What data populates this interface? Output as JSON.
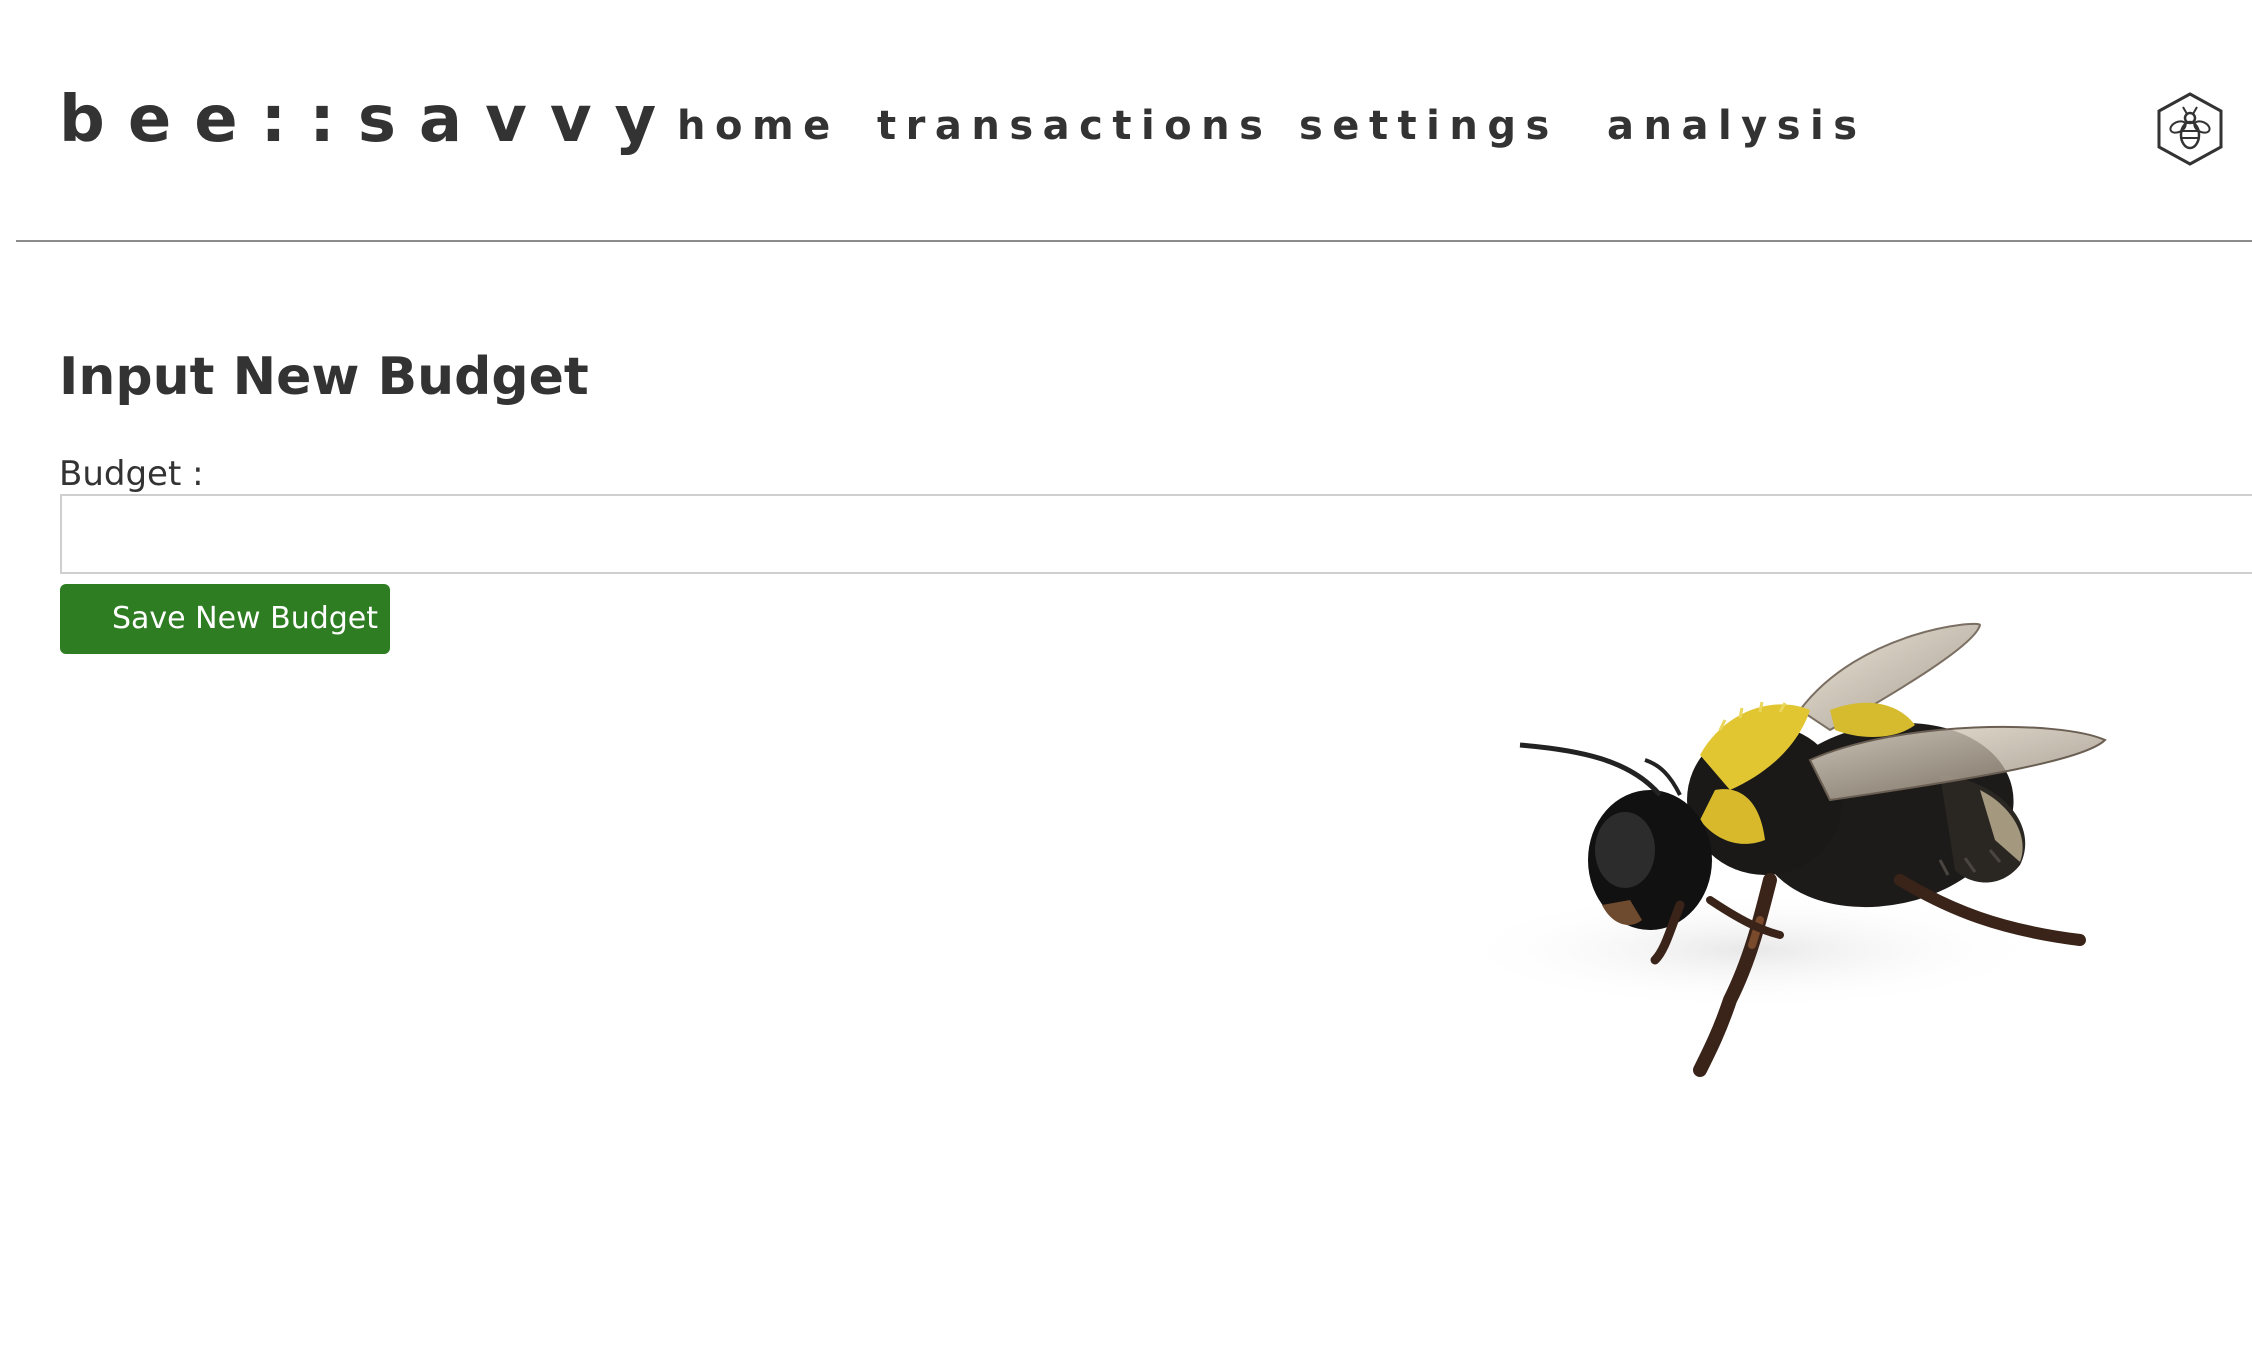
{
  "header": {
    "brand": "bee::savvy",
    "nav": [
      {
        "label": "home"
      },
      {
        "label": "transactions"
      },
      {
        "label": "settings"
      },
      {
        "label": "analysis"
      }
    ],
    "user_icon": "bee-hexagon-icon"
  },
  "main": {
    "title": "Input New Budget",
    "budget_label": "Budget :",
    "budget_input": {
      "value": "",
      "placeholder": ""
    },
    "save_button_label": "Save New Budget"
  },
  "decor": {
    "image": "bumblebee-photo"
  },
  "colors": {
    "text": "#333333",
    "button_bg": "#2e7d23",
    "button_text": "#ffffff",
    "divider": "#8c8c8c",
    "input_border": "#cfcfcf"
  }
}
